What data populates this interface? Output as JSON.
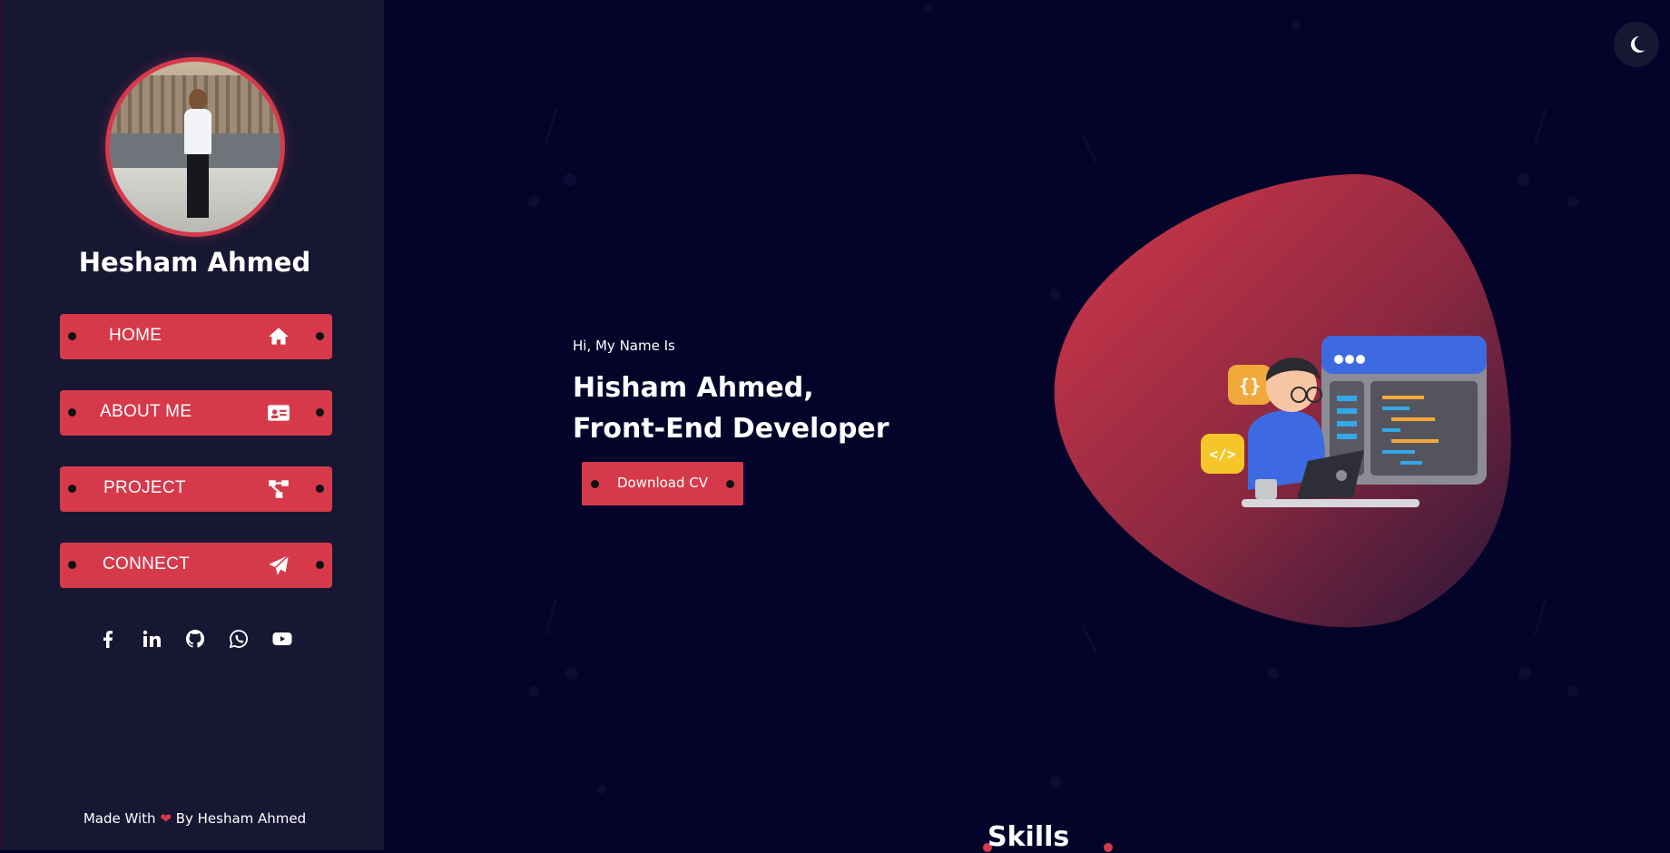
{
  "sidebar": {
    "name": "Hesham Ahmed",
    "nav": [
      {
        "label": "HOME",
        "icon": "home-icon"
      },
      {
        "label": "ABOUT ME",
        "icon": "id-card-icon"
      },
      {
        "label": "PROJECT",
        "icon": "project-tree-icon"
      },
      {
        "label": "CONNECT",
        "icon": "paper-plane-icon"
      }
    ],
    "socials": [
      "facebook-icon",
      "linkedin-icon",
      "github-icon",
      "whatsapp-icon",
      "youtube-icon"
    ],
    "footer": {
      "prefix": "Made With",
      "suffix": "By Hesham Ahmed"
    }
  },
  "hero": {
    "greeting": "Hi, My Name Is",
    "line1": "Hisham Ahmed,",
    "line2": "Front-End Developer",
    "cv_button": "Download CV"
  },
  "skills": {
    "title": "Skills"
  },
  "theme_toggle": {
    "icon": "moon-icon"
  },
  "colors": {
    "accent": "#d63a4a",
    "background": "#04042a",
    "sidebar": "#171733"
  }
}
